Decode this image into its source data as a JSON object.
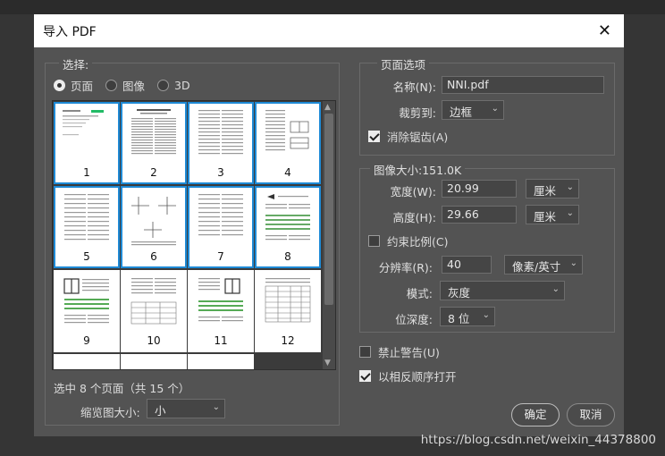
{
  "dialog": {
    "title": "导入 PDF",
    "close_glyph": "✕"
  },
  "select_group": {
    "legend": "选择:",
    "radios": [
      {
        "label": "页面",
        "checked": true
      },
      {
        "label": "图像",
        "checked": false
      },
      {
        "label": "3D",
        "checked": false
      }
    ],
    "thumbnails": [
      {
        "num": "1",
        "selected": true
      },
      {
        "num": "2",
        "selected": true
      },
      {
        "num": "3",
        "selected": true
      },
      {
        "num": "4",
        "selected": true
      },
      {
        "num": "5",
        "selected": true
      },
      {
        "num": "6",
        "selected": true
      },
      {
        "num": "7",
        "selected": true
      },
      {
        "num": "8",
        "selected": true
      },
      {
        "num": "9",
        "selected": false
      },
      {
        "num": "10",
        "selected": false
      },
      {
        "num": "11",
        "selected": false
      },
      {
        "num": "12",
        "selected": false
      }
    ],
    "selection_text": "选中 8 个页面（共 15 个）",
    "thumb_size_label": "缩览图大小:",
    "thumb_size_value": "小"
  },
  "page_options": {
    "legend": "页面选项",
    "name_label": "名称(N):",
    "name_value": "NNI.pdf",
    "crop_label": "裁剪到:",
    "crop_value": "边框",
    "antialias_label": "消除锯齿(A)",
    "antialias_checked": true
  },
  "image_size": {
    "legend": "图像大小:151.0K",
    "width_label": "宽度(W):",
    "width_value": "20.99",
    "width_unit": "厘米",
    "height_label": "高度(H):",
    "height_value": "29.66",
    "height_unit": "厘米",
    "constrain_label": "约束比例(C)",
    "constrain_checked": false,
    "resolution_label": "分辨率(R):",
    "resolution_value": "40",
    "resolution_unit": "像素/英寸",
    "mode_label": "模式:",
    "mode_value": "灰度",
    "depth_label": "位深度:",
    "depth_value": "8 位"
  },
  "options": {
    "suppress_warnings_label": "禁止警告(U)",
    "suppress_warnings_checked": false,
    "reverse_order_label": "以相反顺序打开",
    "reverse_order_checked": true
  },
  "buttons": {
    "ok": "确定",
    "cancel": "取消"
  },
  "watermark": "https://blog.csdn.net/weixin_44378800",
  "colors": {
    "selection_border": "#1e8ad6",
    "dialog_bg": "#535353"
  }
}
